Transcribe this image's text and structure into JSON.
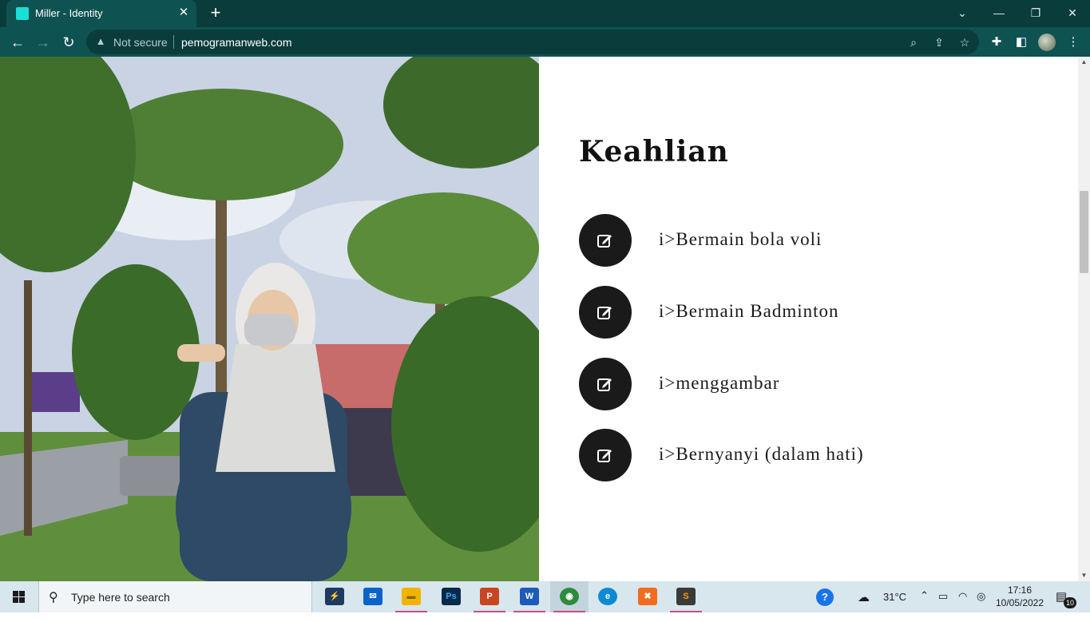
{
  "browser": {
    "tab_title": "Miller - Identity",
    "tab_close": "✕",
    "new_tab": "+",
    "window_controls": {
      "tabsearch": "⌄",
      "minimize": "—",
      "restore": "❐",
      "close": "✕"
    },
    "nav": {
      "back": "←",
      "forward": "→",
      "reload": "↻"
    },
    "security_label": "Not secure",
    "url": "pemogramanweb.com",
    "accent_color": "#0f5252"
  },
  "page": {
    "photo_alt": "Photo of a woman in a hijab standing among palm trees",
    "heading": "Keahlian",
    "skills": [
      {
        "label": "i>Bermain bola voli",
        "icon": "edit-icon"
      },
      {
        "label": "i>Bermain Badminton",
        "icon": "edit-icon"
      },
      {
        "label": "i>menggambar",
        "icon": "edit-icon"
      },
      {
        "label": "i>Bernyanyi (dalam hati)",
        "icon": "edit-icon"
      }
    ]
  },
  "taskbar": {
    "search_placeholder": "Type here to search",
    "weather": "31°C",
    "time": "17:16",
    "date": "10/05/2022",
    "notifications": "10",
    "apps": [
      {
        "name": "visual-studio-app",
        "glyph": "⚡",
        "color": "#1e3a5f"
      },
      {
        "name": "mail-app",
        "glyph": "✉",
        "color": "#0a64c8"
      },
      {
        "name": "file-explorer-app",
        "glyph": "▬",
        "color": "#f0b400"
      },
      {
        "name": "photoshop-app",
        "glyph": "Ps",
        "color": "#0b2a4a"
      },
      {
        "name": "powerpoint-app",
        "glyph": "P",
        "color": "#c8451f"
      },
      {
        "name": "word-app",
        "glyph": "W",
        "color": "#1e5bb8"
      },
      {
        "name": "chrome-app",
        "glyph": "◉",
        "color": "#2e8b3e"
      },
      {
        "name": "edge-app",
        "glyph": "e",
        "color": "#0f8ad1"
      },
      {
        "name": "xampp-app",
        "glyph": "✖",
        "color": "#f06d1e"
      },
      {
        "name": "sublime-app",
        "glyph": "S",
        "color": "#3a3a3a"
      }
    ]
  }
}
